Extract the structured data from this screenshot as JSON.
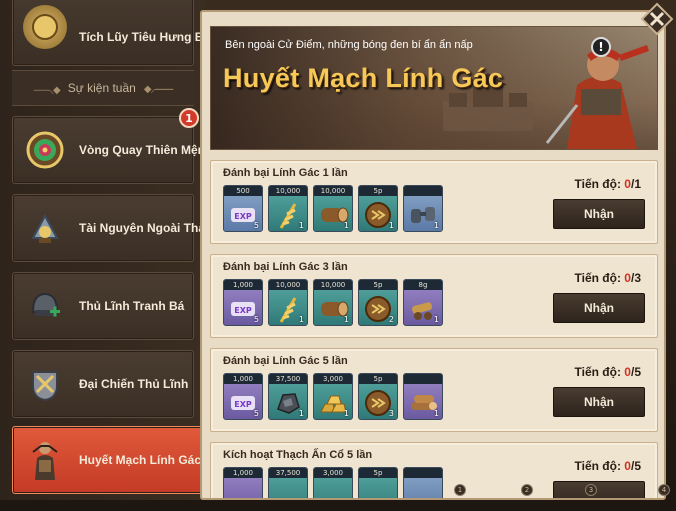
{
  "sidebar": {
    "items": [
      {
        "label": "Tích Lũy Tiêu Hưng Bảo",
        "icon": "treasure-icon"
      },
      {
        "label": "Vòng Quay Thiên Mệnh",
        "icon": "wheel-icon"
      },
      {
        "label": "Tài Nguyên Ngoài Thành",
        "icon": "resources-icon"
      },
      {
        "label": "Thủ Lĩnh Tranh Bá",
        "icon": "helmet-icon"
      },
      {
        "label": "Đại Chiến Thủ Lĩnh",
        "icon": "crossed-swords-icon"
      },
      {
        "label": "Huyết Mạch Lính Gác",
        "icon": "guard-icon"
      }
    ],
    "section_label": "Sự kiện tuần",
    "badge": "1",
    "active_index": 5
  },
  "banner": {
    "subtitle": "Bên ngoài Cử Điểm, những bóng đen bí ẩn ẩn nấp",
    "title": "Huyết Mạch Lính Gác",
    "info": "!"
  },
  "progress_label": "Tiến độ:",
  "claim_label": "Nhận",
  "quests": [
    {
      "title": "Đánh bại Lính Gác 1 lần",
      "current": "0",
      "total": "/1",
      "rewards": [
        {
          "qty": "500",
          "count": "5",
          "icon": "exp-scroll-icon",
          "bg": "blue"
        },
        {
          "qty": "10,000",
          "count": "1",
          "icon": "wheat-icon",
          "bg": "teal"
        },
        {
          "qty": "10,000",
          "count": "1",
          "icon": "wood-log-icon",
          "bg": "teal"
        },
        {
          "qty": "5p",
          "count": "1",
          "icon": "speedup-icon",
          "bg": "teal"
        },
        {
          "qty": "",
          "count": "1",
          "icon": "binoculars-icon",
          "bg": "blue"
        }
      ]
    },
    {
      "title": "Đánh bại Lính Gác 3 lần",
      "current": "0",
      "total": "/3",
      "rewards": [
        {
          "qty": "1,000",
          "count": "5",
          "icon": "exp-scroll-icon",
          "bg": "purple"
        },
        {
          "qty": "10,000",
          "count": "1",
          "icon": "wheat-icon",
          "bg": "teal"
        },
        {
          "qty": "10,000",
          "count": "1",
          "icon": "wood-log-icon",
          "bg": "teal"
        },
        {
          "qty": "5p",
          "count": "2",
          "icon": "speedup-icon",
          "bg": "teal"
        },
        {
          "qty": "8g",
          "count": "1",
          "icon": "cannon-icon",
          "bg": "purple"
        }
      ]
    },
    {
      "title": "Đánh bại Lính Gác 5 lần",
      "current": "0",
      "total": "/5",
      "rewards": [
        {
          "qty": "1,000",
          "count": "5",
          "icon": "exp-scroll-icon",
          "bg": "purple"
        },
        {
          "qty": "37,500",
          "count": "1",
          "icon": "iron-ore-icon",
          "bg": "teal"
        },
        {
          "qty": "3,000",
          "count": "1",
          "icon": "gold-bars-icon",
          "bg": "teal"
        },
        {
          "qty": "5p",
          "count": "3",
          "icon": "speedup-icon",
          "bg": "teal"
        },
        {
          "qty": "",
          "count": "1",
          "icon": "logs-bundle-icon",
          "bg": "purple"
        }
      ]
    },
    {
      "title": "Kích hoạt Thạch Ấn Cổ 5 lần",
      "current": "0",
      "total": "/5",
      "rewards": [
        {
          "qty": "1,000",
          "count": "",
          "icon": "exp-scroll-icon",
          "bg": "purple"
        },
        {
          "qty": "37,500",
          "count": "",
          "icon": "iron-ore-icon",
          "bg": "teal"
        },
        {
          "qty": "3,000",
          "count": "",
          "icon": "gold-bars-icon",
          "bg": "teal"
        },
        {
          "qty": "5p",
          "count": "",
          "icon": "speedup-icon",
          "bg": "teal"
        },
        {
          "qty": "",
          "count": "",
          "icon": "item-icon",
          "bg": "blue"
        }
      ]
    }
  ],
  "pager": [
    "1",
    "2",
    "3",
    "4"
  ]
}
